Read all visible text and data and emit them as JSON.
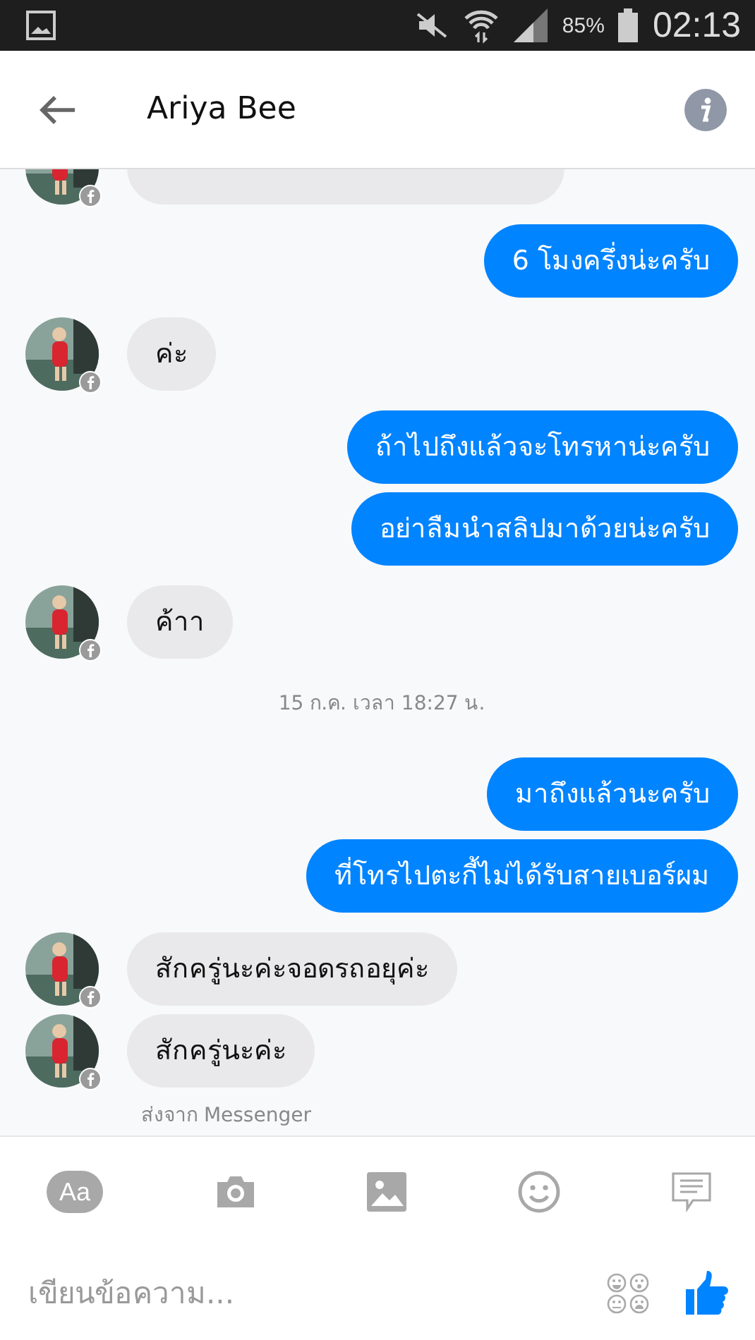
{
  "status_bar": {
    "battery": "85%",
    "time": "02:13"
  },
  "header": {
    "title": "Ariya Bee"
  },
  "messages": [
    {
      "kind": "incoming"
    },
    {
      "kind": "outgoing",
      "text": "6 โมงครึ่งน่ะครับ"
    },
    {
      "kind": "incoming",
      "text": "ค่ะ"
    },
    {
      "kind": "outgoing",
      "text": "ถ้าไปถึงแล้วจะโทรหาน่ะครับ"
    },
    {
      "kind": "outgoing",
      "text": "อย่าลืมนำสลิปมาด้วยน่ะครับ"
    },
    {
      "kind": "incoming",
      "text": "ค้าา"
    },
    {
      "kind": "timestamp",
      "text": "15 ก.ค. เวลา 18:27 น."
    },
    {
      "kind": "outgoing",
      "text": "มาถึงแล้วนะครับ"
    },
    {
      "kind": "outgoing",
      "text": "ที่โทรไปตะกี้ไม่ได้รับสายเบอร์ผม"
    },
    {
      "kind": "incoming",
      "text": "สักครู่นะค่ะจอดรถอยุค่ะ"
    },
    {
      "kind": "incoming",
      "text": "สักครู่นะค่ะ"
    },
    {
      "kind": "footer",
      "text": "ส่งจาก Messenger"
    }
  ],
  "composer": {
    "text_button": "Aa",
    "placeholder": "เขียนข้อความ..."
  }
}
